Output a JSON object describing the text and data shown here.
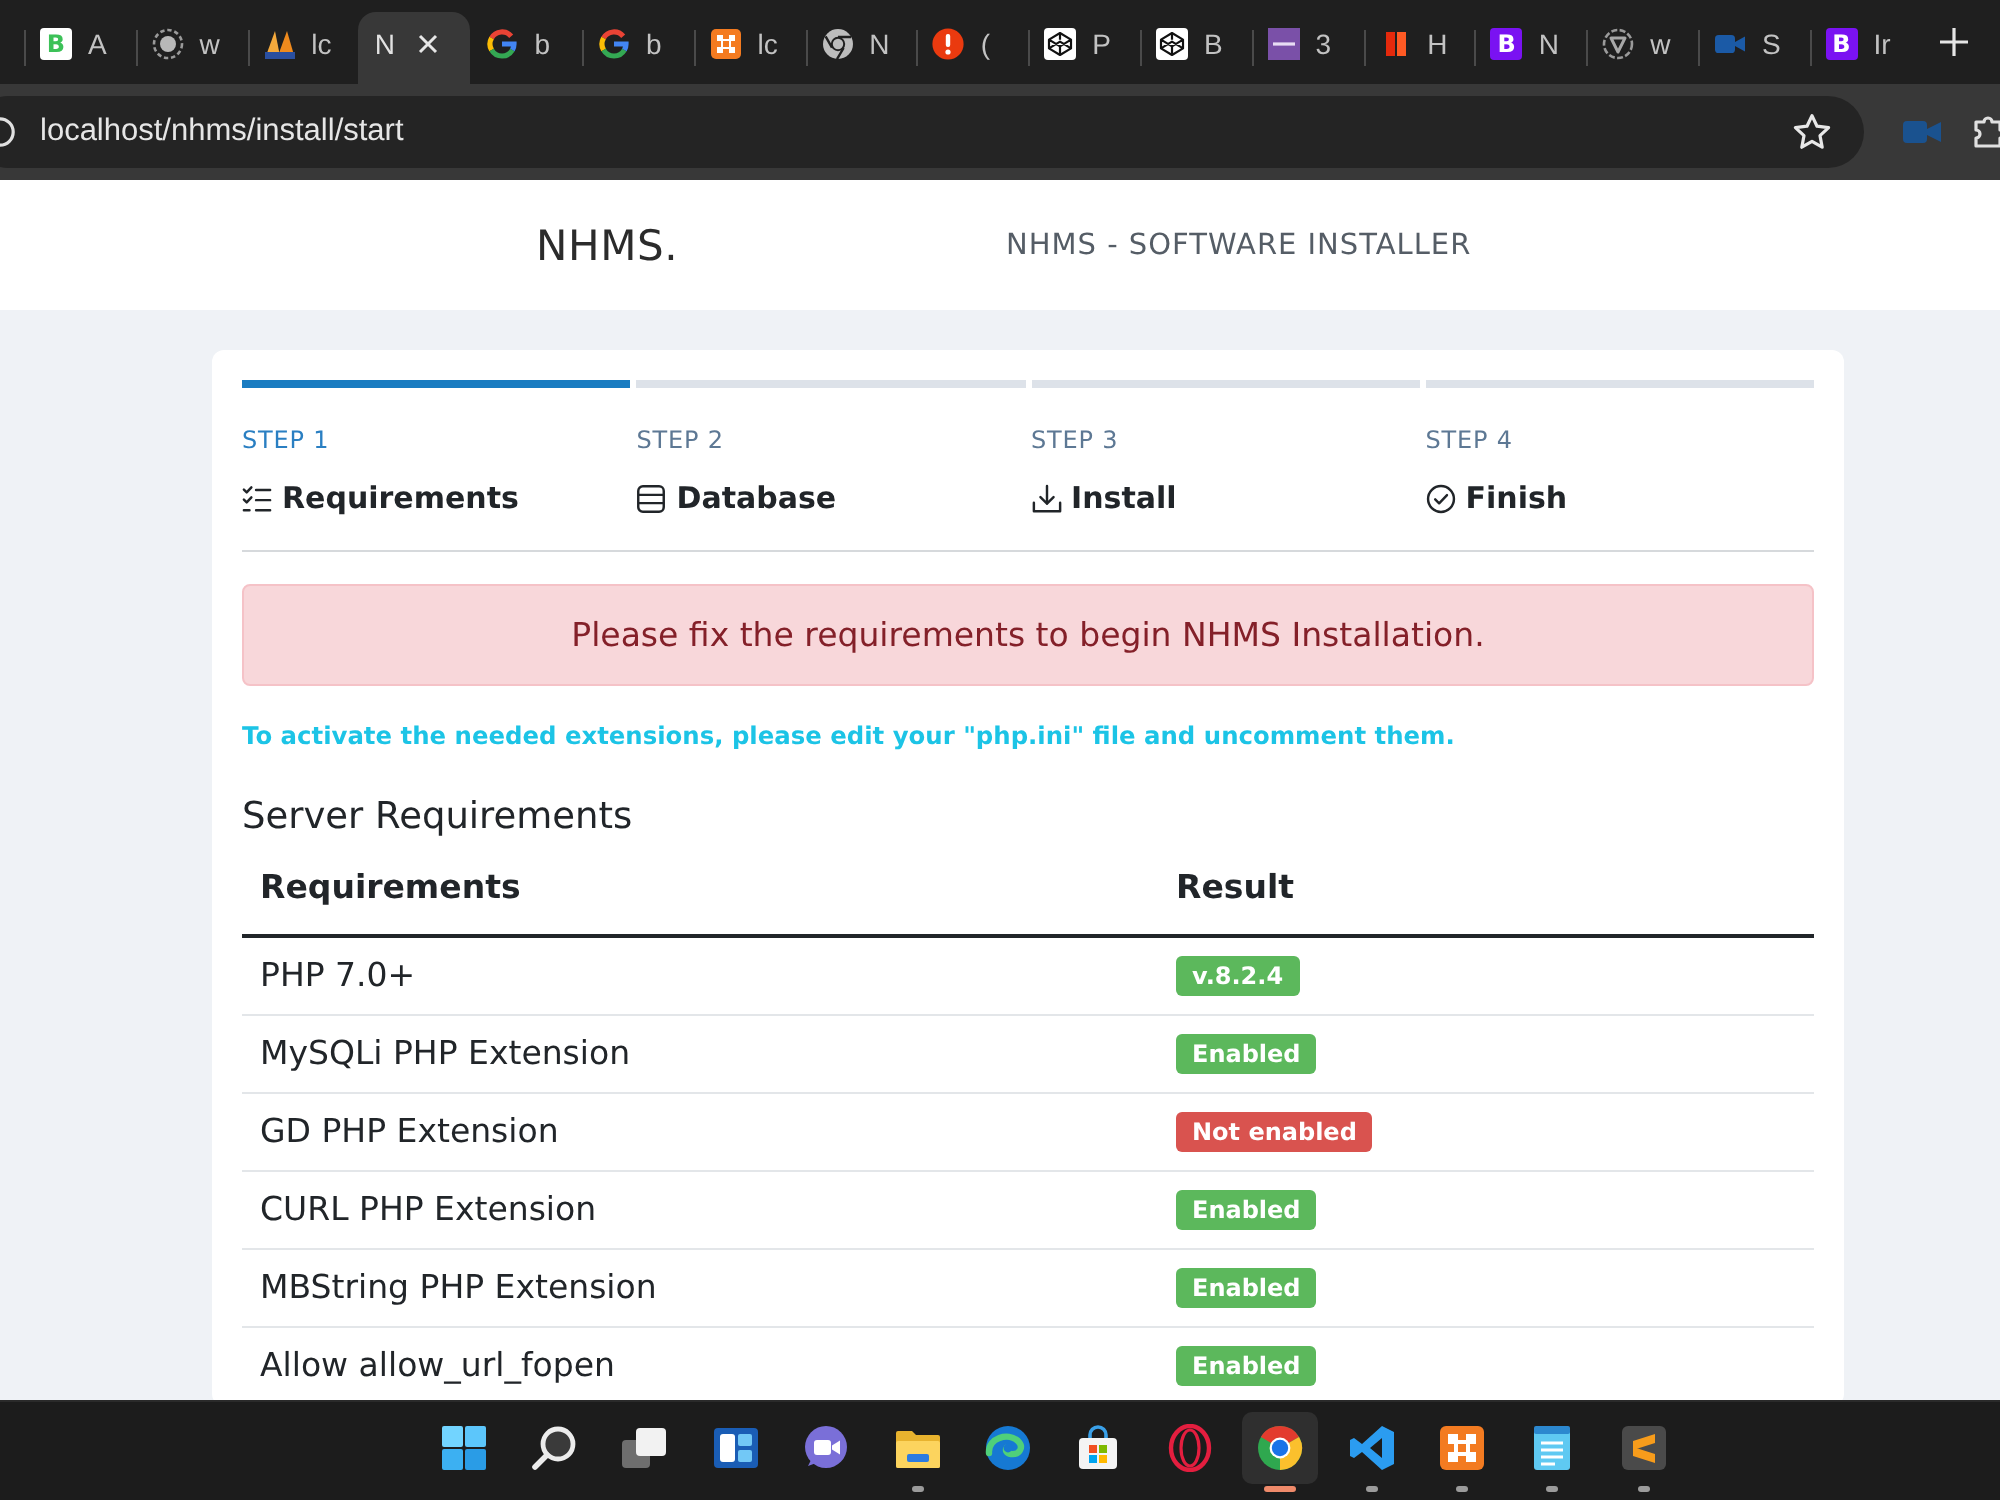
{
  "browser": {
    "tabs": [
      {
        "title": "A",
        "icon_letter": "B",
        "selected": false
      },
      {
        "title": "w",
        "selected": false
      },
      {
        "title": "lc",
        "selected": false
      },
      {
        "title": "N",
        "selected": true
      },
      {
        "title": "b",
        "selected": false
      },
      {
        "title": "b",
        "selected": false
      },
      {
        "title": "lc",
        "selected": false
      },
      {
        "title": "N",
        "selected": false
      },
      {
        "title": "(",
        "selected": false
      },
      {
        "title": "P",
        "selected": false
      },
      {
        "title": "B",
        "selected": false
      },
      {
        "title": "3",
        "selected": false
      },
      {
        "title": "H",
        "selected": false
      },
      {
        "title": "N",
        "icon_letter": "B",
        "selected": false
      },
      {
        "title": "w",
        "selected": false
      },
      {
        "title": "S",
        "selected": false
      },
      {
        "title": "Ir",
        "icon_letter": "B",
        "selected": false
      }
    ],
    "address": "localhost/nhms/install/start"
  },
  "header": {
    "logo": "NHMS.",
    "title": "NHMS - SOFTWARE INSTALLER"
  },
  "steps": [
    {
      "step": "STEP 1",
      "label": "Requirements",
      "selected": true
    },
    {
      "step": "STEP 2",
      "label": "Database",
      "selected": false
    },
    {
      "step": "STEP 3",
      "label": "Install",
      "selected": false
    },
    {
      "step": "STEP 4",
      "label": "Finish",
      "selected": false
    }
  ],
  "alert": "Please fix the requirements to begin NHMS Installation.",
  "hint": "To activate the needed extensions, please edit your \"php.ini\" file and uncomment them.",
  "section_title": "Server Requirements",
  "table": {
    "columns": [
      "Requirements",
      "Result"
    ],
    "rows": [
      {
        "requirement": "PHP 7.0+",
        "result": "v.8.2.4",
        "passed": true
      },
      {
        "requirement": "MySQLi PHP Extension",
        "result": "Enabled",
        "passed": true
      },
      {
        "requirement": "GD PHP Extension",
        "result": "Not enabled",
        "passed": false
      },
      {
        "requirement": "CURL PHP Extension",
        "result": "Enabled",
        "passed": true
      },
      {
        "requirement": "MBString PHP Extension",
        "result": "Enabled",
        "passed": true
      },
      {
        "requirement": "Allow allow_url_fopen",
        "result": "Enabled",
        "passed": true
      }
    ]
  },
  "taskbar": {
    "apps": [
      {
        "running": false,
        "selected": false
      },
      {
        "running": false,
        "selected": false
      },
      {
        "running": false,
        "selected": false
      },
      {
        "running": false,
        "selected": false
      },
      {
        "running": false,
        "selected": false
      },
      {
        "running": true,
        "selected": false
      },
      {
        "running": false,
        "selected": false
      },
      {
        "running": false,
        "selected": false
      },
      {
        "running": false,
        "selected": false
      },
      {
        "running": true,
        "selected": true
      },
      {
        "running": true,
        "selected": false
      },
      {
        "running": true,
        "selected": false
      },
      {
        "running": true,
        "selected": false
      },
      {
        "running": true,
        "selected": false
      }
    ]
  }
}
